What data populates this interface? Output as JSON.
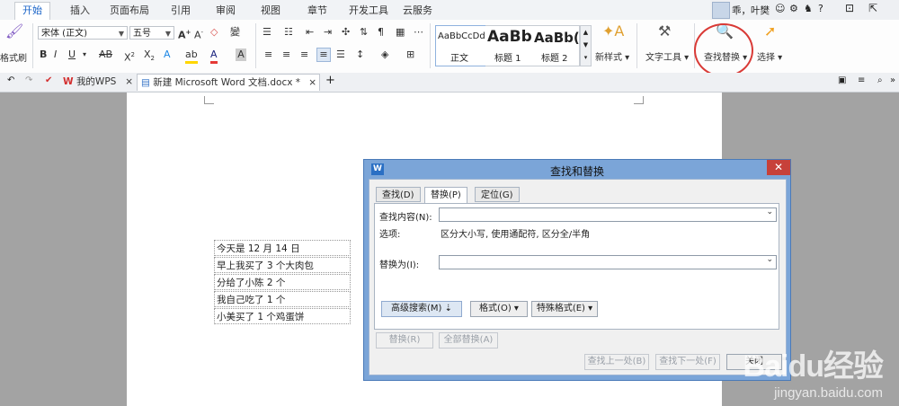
{
  "menu": {
    "items": [
      "开始",
      "插入",
      "页面布局",
      "引用",
      "审阅",
      "视图",
      "章节",
      "开发工具",
      "云服务"
    ],
    "user": "乖，叶樊"
  },
  "ribbon": {
    "format_painter": "格式刷",
    "font_name": "宋体 (正文)",
    "font_size": "五号",
    "style_samples": [
      "AaBbCcDd",
      "AaBb",
      "AaBb("
    ],
    "style_names": [
      "正文",
      "标题 1",
      "标题 2"
    ],
    "new_style": "新样式",
    "text_tools": "文字工具",
    "find_replace": "查找替换",
    "select": "选择"
  },
  "tabs": {
    "home_tab": "我的WPS",
    "doc_tab": "新建 Microsoft Word 文档.docx *"
  },
  "document": {
    "lines": [
      "今天是 12 月 14 日",
      "早上我买了 3 个大肉包",
      "分给了小陈 2 个",
      "我自己吃了 1 个",
      "小美买了 1 个鸡蛋饼"
    ]
  },
  "dialog": {
    "title": "查找和替换",
    "tabs": [
      "查找(D)",
      "替换(P)",
      "定位(G)"
    ],
    "find_label": "查找内容(N):",
    "find_value": "",
    "options_label": "选项:",
    "options_value": "区分大小写, 使用通配符, 区分全/半角",
    "replace_label": "替换为(I):",
    "replace_value": "",
    "advanced_button": "高级搜索(M)",
    "format_button": "格式(O)",
    "special_button": "特殊格式(E)",
    "replace_button": "替换(R)",
    "replace_all_button": "全部替换(A)",
    "find_prev_button": "查找上一处(B)",
    "find_next_button": "查找下一处(F)",
    "close_button": "关闭"
  },
  "watermark": {
    "brand": "Baidu经验",
    "url": "jingyan.baidu.com"
  }
}
